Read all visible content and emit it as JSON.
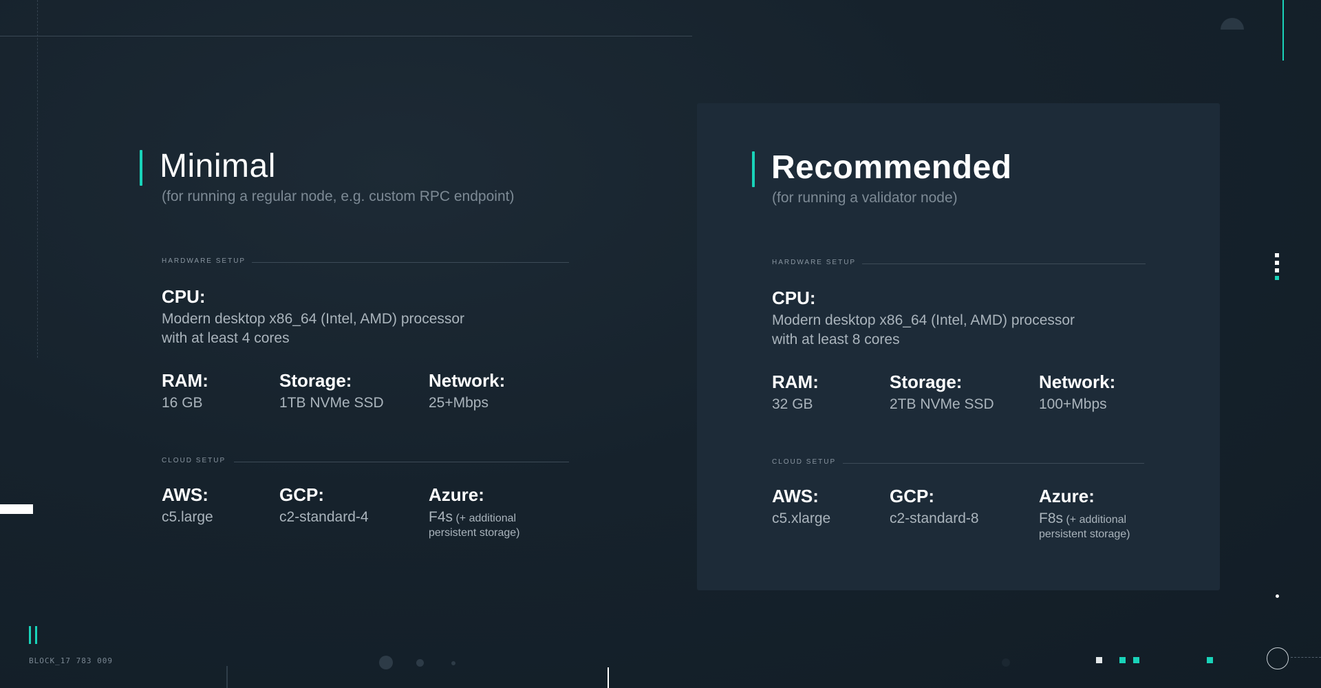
{
  "minimal": {
    "title": "Minimal",
    "subtitle": "(for running a regular node, e.g. custom RPC endpoint)",
    "hardware_label": "HARDWARE SETUP",
    "cpu_label": "CPU:",
    "cpu_line1": "Modern desktop x86_64 (Intel, AMD) processor",
    "cpu_line2": "with at least 4 cores",
    "ram_label": "RAM:",
    "ram_value": "16 GB",
    "storage_label": "Storage:",
    "storage_value": "1TB NVMe SSD",
    "network_label": "Network:",
    "network_value": "25+Mbps",
    "cloud_label": "CLOUD SETUP",
    "aws_label": "AWS:",
    "aws_value": "c5.large",
    "gcp_label": "GCP:",
    "gcp_value": "c2-standard-4",
    "azure_label": "Azure:",
    "azure_value": "F4s",
    "azure_note1": "(+ additional",
    "azure_note2": "persistent storage)"
  },
  "recommended": {
    "title": "Recommended",
    "subtitle": "(for running a validator node)",
    "hardware_label": "HARDWARE SETUP",
    "cpu_label": "CPU:",
    "cpu_line1": "Modern desktop x86_64 (Intel, AMD) processor",
    "cpu_line2": "with at least 8 cores",
    "ram_label": "RAM:",
    "ram_value": "32 GB",
    "storage_label": "Storage:",
    "storage_value": "2TB NVMe SSD",
    "network_label": "Network:",
    "network_value": "100+Mbps",
    "cloud_label": "CLOUD SETUP",
    "aws_label": "AWS:",
    "aws_value": "c5.xlarge",
    "gcp_label": "GCP:",
    "gcp_value": "c2-standard-8",
    "azure_label": "Azure:",
    "azure_value": "F8s",
    "azure_note1": "(+ additional",
    "azure_note2": "persistent storage)"
  },
  "footer": {
    "block_label": "BLOCK_17 783 009"
  },
  "colors": {
    "accent": "#19d3b9",
    "background": "#16222c",
    "panel": "#1d2b38"
  }
}
